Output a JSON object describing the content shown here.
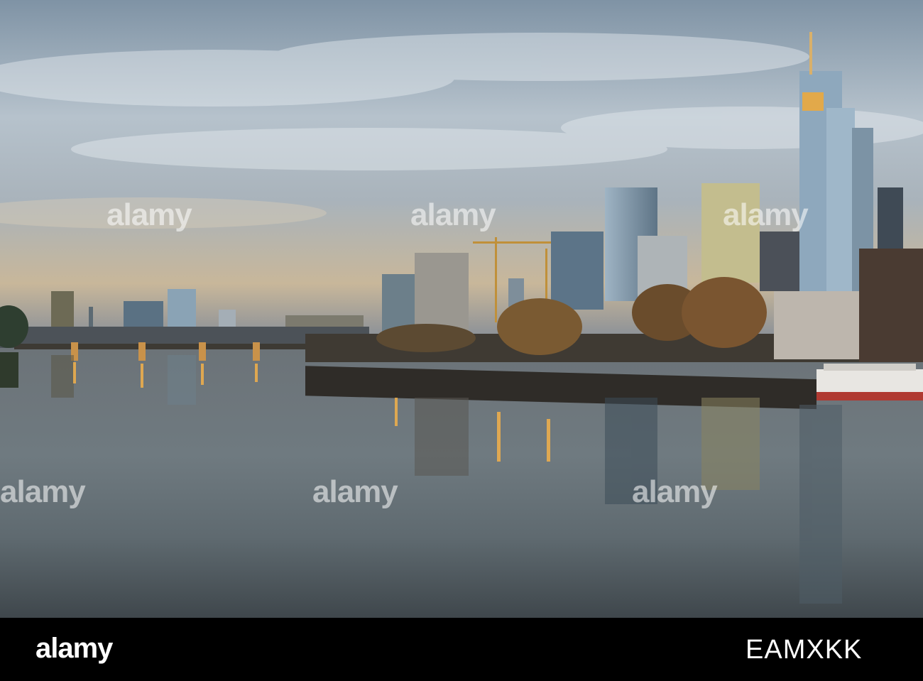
{
  "watermark": {
    "text": "alamy"
  },
  "footer": {
    "logo": "alamy",
    "image_code": "EAMXKK"
  },
  "colors": {
    "sky_top": "#8a9aa8",
    "sky_horizon": "#c9b89a",
    "water": "#5e6a70",
    "footer_bg": "#000000"
  }
}
